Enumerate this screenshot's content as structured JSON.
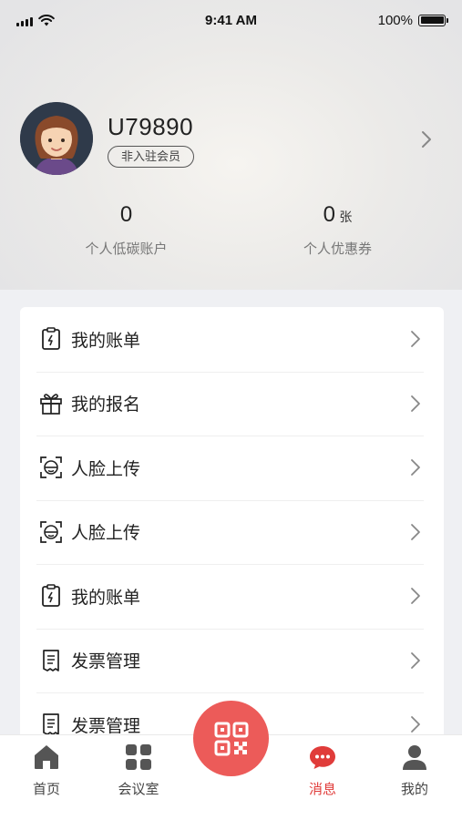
{
  "status_bar": {
    "time": "9:41 AM",
    "battery": "100%"
  },
  "profile": {
    "username": "U79890",
    "membership_badge": "非入驻会员",
    "avatar_icon": "user-avatar-icon"
  },
  "stats": [
    {
      "value": "0",
      "unit": "",
      "label": "个人低碳账户"
    },
    {
      "value": "0",
      "unit": "张",
      "label": "个人优惠券"
    }
  ],
  "menu": {
    "items": [
      {
        "label": "我的账单",
        "icon": "bill-clipboard-icon"
      },
      {
        "label": "我的报名",
        "icon": "gift-icon"
      },
      {
        "label": "人脸上传",
        "icon": "face-scan-icon"
      },
      {
        "label": "人脸上传",
        "icon": "face-scan-icon"
      },
      {
        "label": "我的账单",
        "icon": "bill-clipboard-icon"
      },
      {
        "label": "发票管理",
        "icon": "invoice-icon"
      },
      {
        "label": "发票管理",
        "icon": "invoice-icon"
      }
    ]
  },
  "tab_bar": {
    "tabs": [
      {
        "label": "首页",
        "icon": "home-icon",
        "active": false
      },
      {
        "label": "会议室",
        "icon": "grid-icon",
        "active": false
      },
      {
        "label": "消息",
        "icon": "message-bubble-icon",
        "active": true
      },
      {
        "label": "我的",
        "icon": "person-icon",
        "active": false
      }
    ],
    "center_button_icon": "qr-code-icon"
  },
  "colors": {
    "accent": "#e03c3a",
    "scan_button": "#ec5b59",
    "page_background": "#eff0f3",
    "card_background": "#ffffff"
  }
}
